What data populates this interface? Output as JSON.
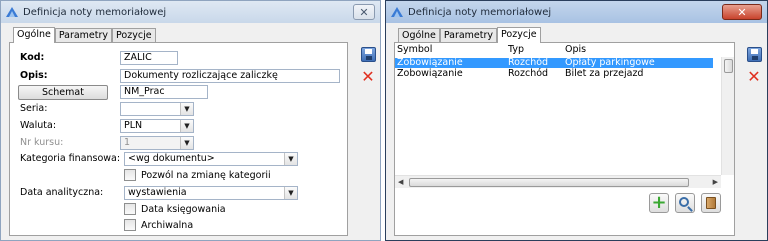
{
  "window1": {
    "title": "Definicja noty memoriałowej",
    "close_glyph": "✕",
    "tabs": [
      "Ogólne",
      "Parametry",
      "Pozycje"
    ],
    "active_tab": "Ogólne",
    "form": {
      "kod_label": "Kod:",
      "kod_value": "ZALIC",
      "opis_label": "Opis:",
      "opis_value": "Dokumenty rozliczające zaliczkę",
      "schemat_button": "Schemat",
      "schemat_value": "NM_Prac",
      "seria_label": "Seria:",
      "seria_value": "",
      "waluta_label": "Waluta:",
      "waluta_value": "PLN",
      "nr_kursu_label": "Nr kursu:",
      "nr_kursu_value": "1",
      "kategoria_label": "Kategoria finansowa:",
      "kategoria_value": "<wg dokumentu>",
      "pozwol_label": "Pozwól na zmianę kategorii",
      "data_analityczna_label": "Data analityczna:",
      "data_analityczna_value": "wystawienia",
      "data_ksiegowania_label": "Data księgowania",
      "archiwalna_label": "Archiwalna"
    }
  },
  "window2": {
    "title": "Definicja noty memoriałowej",
    "close_glyph": "✕",
    "tabs": [
      "Ogólne",
      "Parametry",
      "Pozycje"
    ],
    "active_tab": "Pozycje",
    "list": {
      "columns": [
        "Symbol",
        "Typ",
        "Opis"
      ],
      "rows": [
        {
          "symbol": "Zobowiązanie",
          "typ": "Rozchód",
          "opis": "Opłaty parkingowe",
          "selected": true
        },
        {
          "symbol": "Zobowiązanie",
          "typ": "Rozchód",
          "opis": "Bilet za przejazd",
          "selected": false
        }
      ]
    }
  },
  "icons": {
    "save": "save-icon",
    "cancel": "cancel-icon",
    "add": "plus-icon",
    "search": "magnifier-icon",
    "delete": "trash-icon"
  },
  "colors": {
    "selection": "#3399ff",
    "cancel_red": "#e03020",
    "add_green": "#3aa832"
  }
}
